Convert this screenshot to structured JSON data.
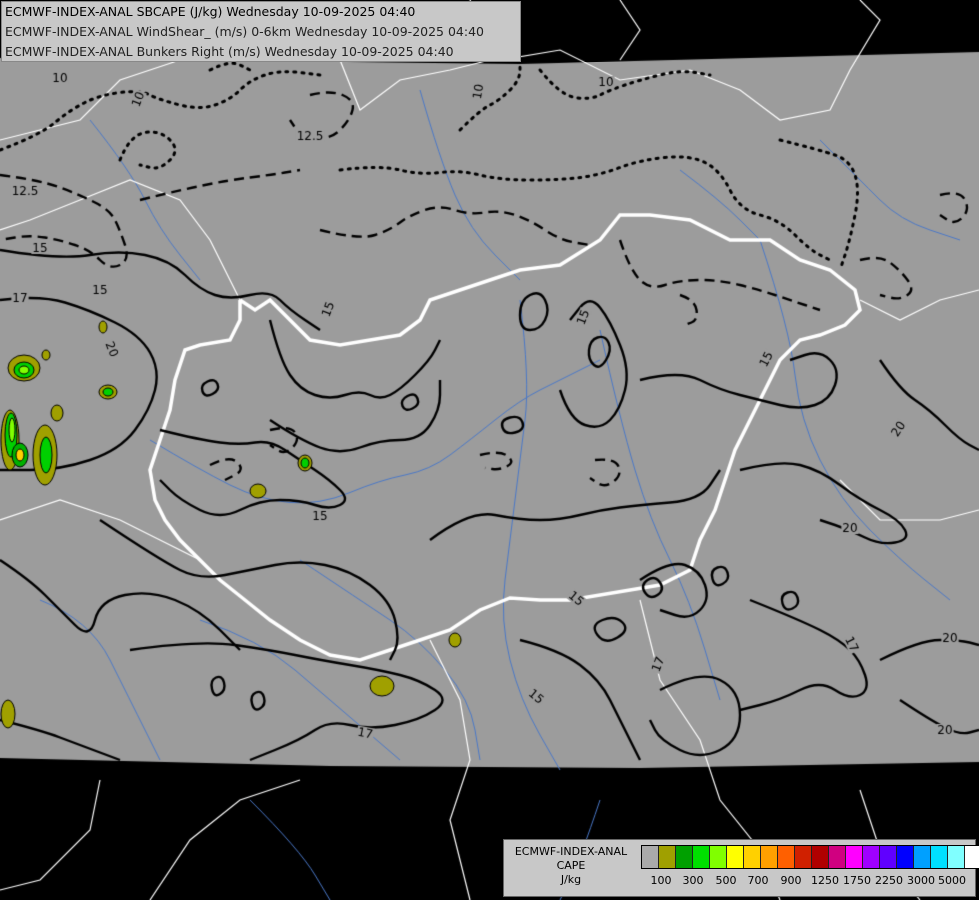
{
  "header": {
    "lines": [
      "ECMWF-INDEX-ANAL SBCAPE (J/kg) Wednesday 10-09-2025 04:40",
      "ECMWF-INDEX-ANAL WindShear_ (m/s) 0-6km Wednesday 10-09-2025 04:40",
      "ECMWF-INDEX-ANAL Bunkers Right (m/s) Wednesday 10-09-2025 04:40"
    ]
  },
  "legend": {
    "title": "ECMWF-INDEX-ANAL",
    "variable": "CAPE",
    "unit": "J/kg",
    "colors": [
      "#aaaaaa",
      "#a0a000",
      "#00a000",
      "#00e000",
      "#80ff00",
      "#ffff00",
      "#ffd000",
      "#ffa000",
      "#ff6000",
      "#d02000",
      "#b00000",
      "#d00080",
      "#ff00ff",
      "#a000ff",
      "#6000ff",
      "#0000ff",
      "#00a0ff",
      "#00e0ff",
      "#80ffff",
      "#ffffff"
    ],
    "tick_labels": [
      "100",
      "300",
      "500",
      "700",
      "900",
      "1250",
      "1750",
      "2250",
      "3000",
      "5000"
    ]
  },
  "contour_labels": {
    "windshear": [
      "10",
      "10",
      "10",
      "10",
      "12.5",
      "12.5",
      "15",
      "15",
      "15",
      "15",
      "15",
      "15",
      "15",
      "15",
      "17",
      "17",
      "17",
      "17",
      "20",
      "20",
      "20",
      "20",
      "20"
    ]
  }
}
